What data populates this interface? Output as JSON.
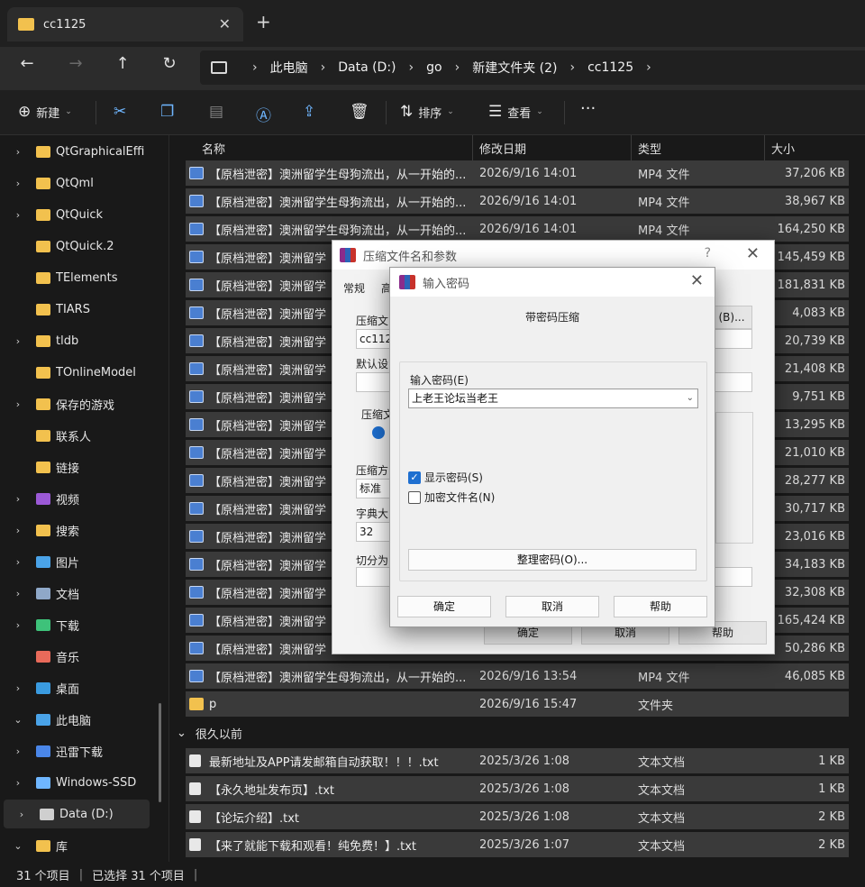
{
  "tab": {
    "title": "cc1125",
    "close": "✕",
    "new": "+"
  },
  "nav": {
    "back": "←",
    "forward": "→",
    "up": "↑",
    "refresh": "↻",
    "more": "›"
  },
  "breadcrumb": [
    "此电脑",
    "Data (D:)",
    "go",
    "新建文件夹 (2)",
    "cc1125"
  ],
  "toolbar": {
    "new_label": "新建",
    "sort_label": "排序",
    "view_label": "查看",
    "more": "···"
  },
  "sidebar": {
    "items": [
      {
        "label": "QtGraphicalEffi",
        "icon": "folder-icon",
        "expand": "›"
      },
      {
        "label": "QtQml",
        "icon": "folder-icon",
        "expand": "›"
      },
      {
        "label": "QtQuick",
        "icon": "folder-icon",
        "expand": "›"
      },
      {
        "label": "QtQuick.2",
        "icon": "folder-icon",
        "expand": ""
      },
      {
        "label": "TElements",
        "icon": "folder-icon",
        "expand": ""
      },
      {
        "label": "TIARS",
        "icon": "folder-icon",
        "expand": ""
      },
      {
        "label": "tldb",
        "icon": "folder-icon",
        "expand": "›"
      },
      {
        "label": "TOnlineModel",
        "icon": "folder-icon",
        "expand": ""
      },
      {
        "label": "保存的游戏",
        "icon": "folder-icon",
        "expand": "›"
      },
      {
        "label": "联系人",
        "icon": "folder-icon",
        "expand": ""
      },
      {
        "label": "链接",
        "icon": "folder-icon",
        "expand": ""
      },
      {
        "label": "视频",
        "icon": "video-folder-icon",
        "expand": "›"
      },
      {
        "label": "搜索",
        "icon": "folder-icon",
        "expand": "›"
      },
      {
        "label": "图片",
        "icon": "pictures-icon",
        "expand": "›"
      },
      {
        "label": "文档",
        "icon": "documents-icon",
        "expand": "›"
      },
      {
        "label": "下载",
        "icon": "download-icon",
        "expand": "›"
      },
      {
        "label": "音乐",
        "icon": "music-icon",
        "expand": ""
      },
      {
        "label": "桌面",
        "icon": "desktop-icon",
        "expand": "›"
      },
      {
        "label": "此电脑",
        "icon": "this-pc-icon",
        "expand": "⌄"
      },
      {
        "label": "迅雷下载",
        "icon": "thunder-drive-icon",
        "expand": "›"
      },
      {
        "label": "Windows-SSD",
        "icon": "windows-drive-icon",
        "expand": "›"
      },
      {
        "label": "Data (D:)",
        "icon": "drive-icon",
        "expand": "›"
      },
      {
        "label": "库",
        "icon": "library-icon",
        "expand": "⌄"
      }
    ]
  },
  "columns": {
    "name": "名称",
    "date": "修改日期",
    "type": "类型",
    "size": "大小"
  },
  "files": [
    {
      "name": "【原档泄密】澳洲留学生母狗流出，从一开始的...",
      "date": "2026/9/16 14:01",
      "type": "MP4 文件",
      "size": "37,206 KB"
    },
    {
      "name": "【原档泄密】澳洲留学生母狗流出，从一开始的...",
      "date": "2026/9/16 14:01",
      "type": "MP4 文件",
      "size": "38,967 KB"
    },
    {
      "name": "【原档泄密】澳洲留学生母狗流出，从一开始的...",
      "date": "2026/9/16 14:01",
      "type": "MP4 文件",
      "size": "164,250 KB"
    },
    {
      "name": "【原档泄密】澳洲留学",
      "date": "",
      "type": "",
      "size": "145,459 KB"
    },
    {
      "name": "【原档泄密】澳洲留学",
      "date": "",
      "type": "",
      "size": "181,831 KB"
    },
    {
      "name": "【原档泄密】澳洲留学",
      "date": "",
      "type": "",
      "size": "4,083 KB"
    },
    {
      "name": "【原档泄密】澳洲留学",
      "date": "",
      "type": "",
      "size": "20,739 KB"
    },
    {
      "name": "【原档泄密】澳洲留学",
      "date": "",
      "type": "",
      "size": "21,408 KB"
    },
    {
      "name": "【原档泄密】澳洲留学",
      "date": "",
      "type": "",
      "size": "9,751 KB"
    },
    {
      "name": "【原档泄密】澳洲留学",
      "date": "",
      "type": "",
      "size": "13,295 KB"
    },
    {
      "name": "【原档泄密】澳洲留学",
      "date": "",
      "type": "",
      "size": "21,010 KB"
    },
    {
      "name": "【原档泄密】澳洲留学",
      "date": "",
      "type": "",
      "size": "28,277 KB"
    },
    {
      "name": "【原档泄密】澳洲留学",
      "date": "",
      "type": "",
      "size": "30,717 KB"
    },
    {
      "name": "【原档泄密】澳洲留学",
      "date": "",
      "type": "",
      "size": "23,016 KB"
    },
    {
      "name": "【原档泄密】澳洲留学",
      "date": "",
      "type": "",
      "size": "34,183 KB"
    },
    {
      "name": "【原档泄密】澳洲留学",
      "date": "",
      "type": "",
      "size": "32,308 KB"
    },
    {
      "name": "【原档泄密】澳洲留学",
      "date": "",
      "type": "",
      "size": "165,424 KB"
    },
    {
      "name": "【原档泄密】澳洲留学",
      "date": "",
      "type": "",
      "size": "50,286 KB"
    },
    {
      "name": "【原档泄密】澳洲留学生母狗流出，从一开始的...",
      "date": "2026/9/16 13:54",
      "type": "MP4 文件",
      "size": "46,085 KB"
    }
  ],
  "folder_row": {
    "name": "p",
    "date": "2026/9/16 15:47",
    "type": "文件夹",
    "size": ""
  },
  "group_label": "很久以前",
  "old_files": [
    {
      "name": "最新地址及APP请发邮箱自动获取！！！.txt",
      "date": "2025/3/26 1:08",
      "type": "文本文档",
      "size": "1 KB"
    },
    {
      "name": "【永久地址发布页】.txt",
      "date": "2025/3/26 1:08",
      "type": "文本文档",
      "size": "1 KB"
    },
    {
      "name": "【论坛介绍】.txt",
      "date": "2025/3/26 1:08",
      "type": "文本文档",
      "size": "2 KB"
    },
    {
      "name": "【来了就能下载和观看！纯免费！】.txt",
      "date": "2025/3/26 1:07",
      "type": "文本文档",
      "size": "2 KB"
    }
  ],
  "status": {
    "count": "31 个项目",
    "selected": "已选择 31 个项目"
  },
  "archive_dialog": {
    "title": "压缩文件名和参数",
    "help": "?",
    "close": "✕",
    "tab_general": "常规",
    "tab_partial": "高",
    "lbl_archive_name": "压缩文",
    "archive_value": "cc1125",
    "browse_button": "(B)...",
    "lbl_default": "默认设",
    "lbl_format": "压缩文",
    "lbl_method": "压缩方",
    "method_value": "标准",
    "lbl_dict": "字典大",
    "dict_value": "32",
    "lbl_split": "切分为",
    "ok": "确定",
    "cancel": "取消",
    "help_btn": "帮助"
  },
  "password_dialog": {
    "title": "输入密码",
    "close": "✕",
    "heading": "带密码压缩",
    "label": "输入密码(E)",
    "password_value": "上老王论坛当老王",
    "show_password": "显示密码(S)",
    "encrypt_names": "加密文件名(N)",
    "manage_button": "整理密码(O)...",
    "ok": "确定",
    "cancel": "取消",
    "help": "帮助"
  },
  "colors": {
    "accent": "#1e6fd0",
    "folder": "#f2c14e",
    "row_selected": "#3a3a3a",
    "background": "#191919"
  }
}
